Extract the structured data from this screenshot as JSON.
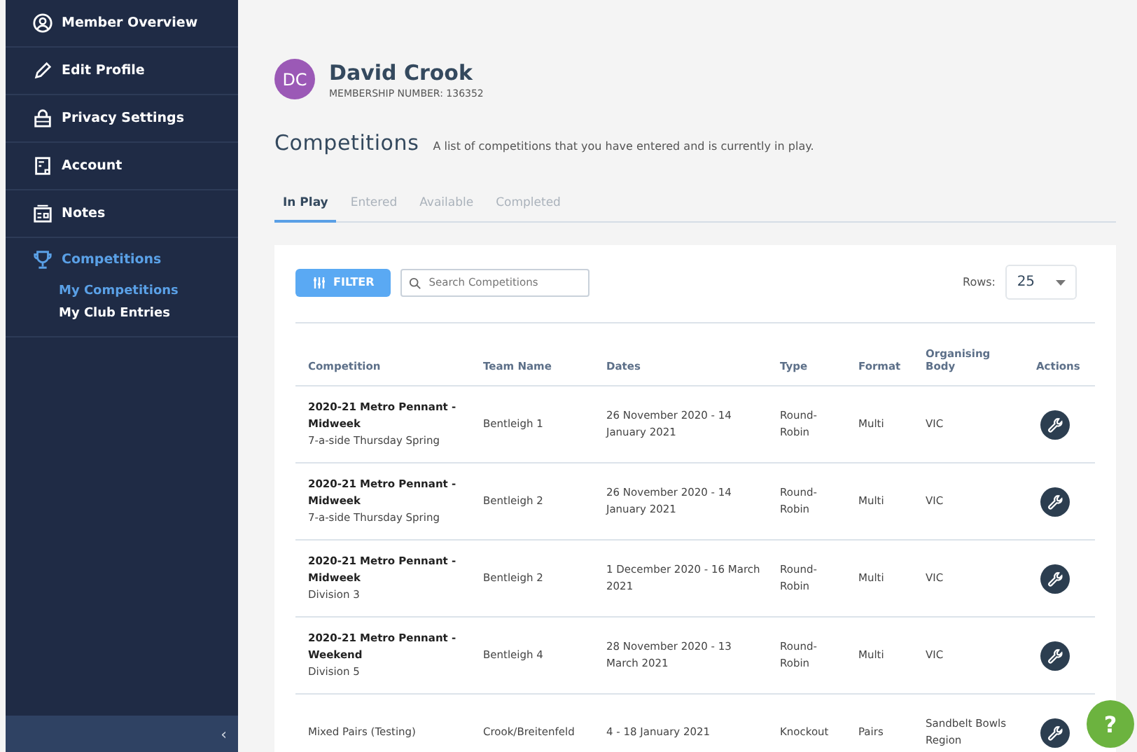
{
  "sidebar": {
    "items": [
      {
        "label": "Member Overview",
        "selected": false
      },
      {
        "label": "Edit Profile",
        "selected": false
      },
      {
        "label": "Privacy Settings",
        "selected": false
      },
      {
        "label": "Account",
        "selected": false
      },
      {
        "label": "Notes",
        "selected": false
      },
      {
        "label": "Competitions",
        "selected": true,
        "children": [
          {
            "label": "My Competitions",
            "selected": true
          },
          {
            "label": "My Club Entries",
            "selected": false
          }
        ]
      }
    ],
    "collapse": "‹"
  },
  "member": {
    "initials": "DC",
    "name": "David Crook",
    "membership": "MEMBERSHIP NUMBER: 136352"
  },
  "page": {
    "title": "Competitions",
    "subtitle": "A list of competitions that you have entered and is currently in play."
  },
  "tabs": [
    {
      "label": "In Play",
      "selected": true
    },
    {
      "label": "Entered",
      "selected": false
    },
    {
      "label": "Available",
      "selected": false
    },
    {
      "label": "Completed",
      "selected": false
    }
  ],
  "toolbar": {
    "filter": "FILTER",
    "search_placeholder": "Search Competitions",
    "rows_label": "Rows:",
    "rows_value": "25"
  },
  "table": {
    "columns": [
      "Competition",
      "Team Name",
      "Dates",
      "Type",
      "Format",
      "Organising Body",
      "Actions"
    ],
    "rows": [
      {
        "competition": "2020-21 Metro Pennant - Midweek",
        "bold": true,
        "subtitle": "7-a-side Thursday Spring",
        "team": "Bentleigh 1",
        "dates": "26 November 2020 - 14 January 2021",
        "type": "Round-Robin",
        "format": "Multi",
        "body": "VIC"
      },
      {
        "competition": "2020-21 Metro Pennant - Midweek",
        "bold": true,
        "subtitle": "7-a-side Thursday Spring",
        "team": "Bentleigh 2",
        "dates": "26 November 2020 - 14 January 2021",
        "type": "Round-Robin",
        "format": "Multi",
        "body": "VIC"
      },
      {
        "competition": "2020-21 Metro Pennant - Midweek",
        "bold": true,
        "subtitle": "Division 3",
        "team": "Bentleigh 2",
        "dates": "1 December 2020 - 16 March 2021",
        "type": "Round-Robin",
        "format": "Multi",
        "body": "VIC"
      },
      {
        "competition": "2020-21 Metro Pennant - Weekend",
        "bold": true,
        "subtitle": "Division 5",
        "team": "Bentleigh 4",
        "dates": "28 November 2020 - 13 March 2021",
        "type": "Round-Robin",
        "format": "Multi",
        "body": "VIC"
      },
      {
        "competition": "Mixed Pairs (Testing)",
        "bold": false,
        "team": "Crook/Breitenfeld",
        "dates": "4 - 18 January 2021",
        "type": "Knockout",
        "format": "Pairs",
        "body": "Sandbelt Bowls Region"
      }
    ]
  },
  "help_button": "?"
}
